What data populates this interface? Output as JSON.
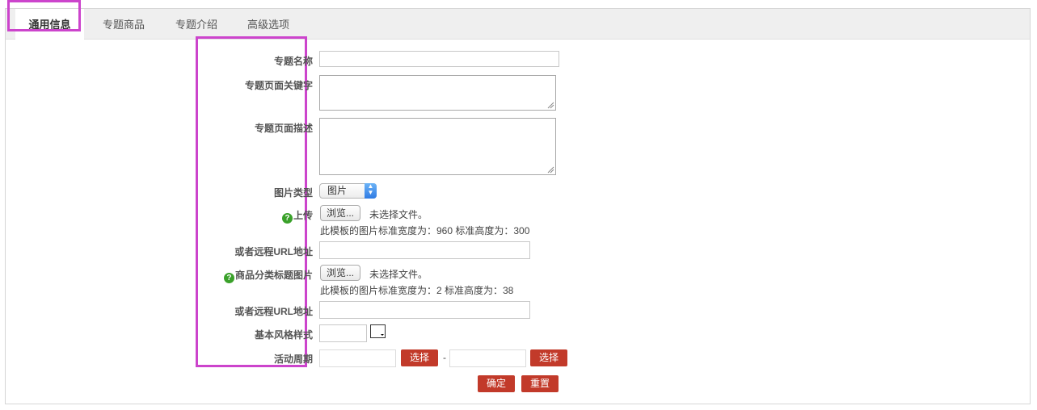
{
  "tabs": [
    "通用信息",
    "专题商品",
    "专题介绍",
    "高级选项"
  ],
  "labels": {
    "name": "专题名称",
    "keywords": "专题页面关键字",
    "description": "专题页面描述",
    "image_type": "图片类型",
    "upload": "上传",
    "remote_url_1": "或者远程URL地址",
    "category_image": "商品分类标题图片",
    "remote_url_2": "或者远程URL地址",
    "style": "基本风格样式",
    "period": "活动周期"
  },
  "image_type": {
    "selected": "图片"
  },
  "upload": {
    "browse_label": "浏览...",
    "no_file": "未选择文件。",
    "hint": "此模板的图片标准宽度为：960 标准高度为：300"
  },
  "category_image": {
    "browse_label": "浏览...",
    "no_file": "未选择文件。",
    "hint": "此模板的图片标准宽度为：2 标准高度为：38"
  },
  "period": {
    "select_label": "选择",
    "separator": "-"
  },
  "actions": {
    "confirm": "确定",
    "reset": "重置"
  },
  "colors": {
    "accent_red": "#c23a2a",
    "highlight": "#cc44cc",
    "help_green": "#3aa12a"
  }
}
